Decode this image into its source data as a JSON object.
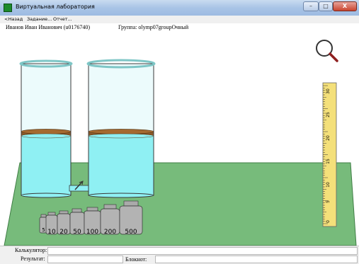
{
  "window": {
    "title": "Виртуальная лаборатория",
    "close_label": "X"
  },
  "menu": {
    "items": [
      "<Назад",
      "Задание...",
      "Отчет..."
    ]
  },
  "student": {
    "name": "Иванов Иван Иванович (u0176740)",
    "group": "Группа: olymp07groupОчный"
  },
  "weights": [
    "5",
    "10",
    "20",
    "50",
    "100",
    "200",
    "500"
  ],
  "ruler": {
    "labels": [
      "30",
      "25",
      "20",
      "15",
      "10",
      "5",
      "0"
    ]
  },
  "bottom": {
    "calculator_label": "Калькулятор:",
    "result_label": "Результат:",
    "notepad_label": "Блокнот:"
  },
  "colors": {
    "table": "#77bb7b",
    "water": "#8ff0f3",
    "oil": "#8b5a2b",
    "ruler": "#f4e07a",
    "background": "#ffffff"
  }
}
